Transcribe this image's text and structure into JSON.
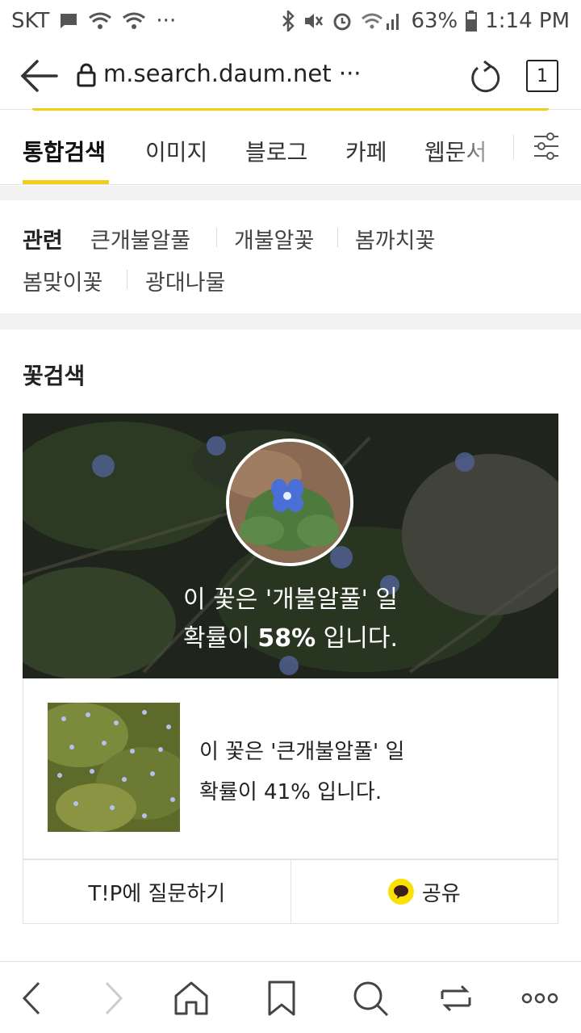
{
  "status_bar": {
    "carrier": "SKT",
    "dots": "···",
    "battery": "63%",
    "time": "1:14 PM"
  },
  "browser": {
    "url": "m.search.daum.net ···",
    "tab_count": "1"
  },
  "search_tabs": [
    {
      "label": "통합검색",
      "active": true
    },
    {
      "label": "이미지",
      "active": false
    },
    {
      "label": "블로그",
      "active": false
    },
    {
      "label": "카페",
      "active": false
    },
    {
      "label": "웹문서",
      "active": false
    }
  ],
  "related": {
    "label": "관련",
    "items": [
      "큰개불알풀",
      "개불알꽃",
      "봄까치꽃",
      "봄맞이꽃",
      "광대나물"
    ]
  },
  "flower_search": {
    "title": "꽃검색",
    "top_result": {
      "line1": "이 꽃은 '개불알풀' 일",
      "line2_prefix": "확률이 ",
      "line2_percent": "58%",
      "line2_suffix": " 입니다."
    },
    "second_result": {
      "line1": "이 꽃은 '큰개불알풀' 일",
      "line2": "확률이 41% 입니다."
    },
    "actions": {
      "ask_tip": "T!P에 질문하기",
      "share": "공유"
    }
  },
  "icons": {
    "accent": "#f2cf16",
    "kakao_yellow": "#fae100"
  }
}
